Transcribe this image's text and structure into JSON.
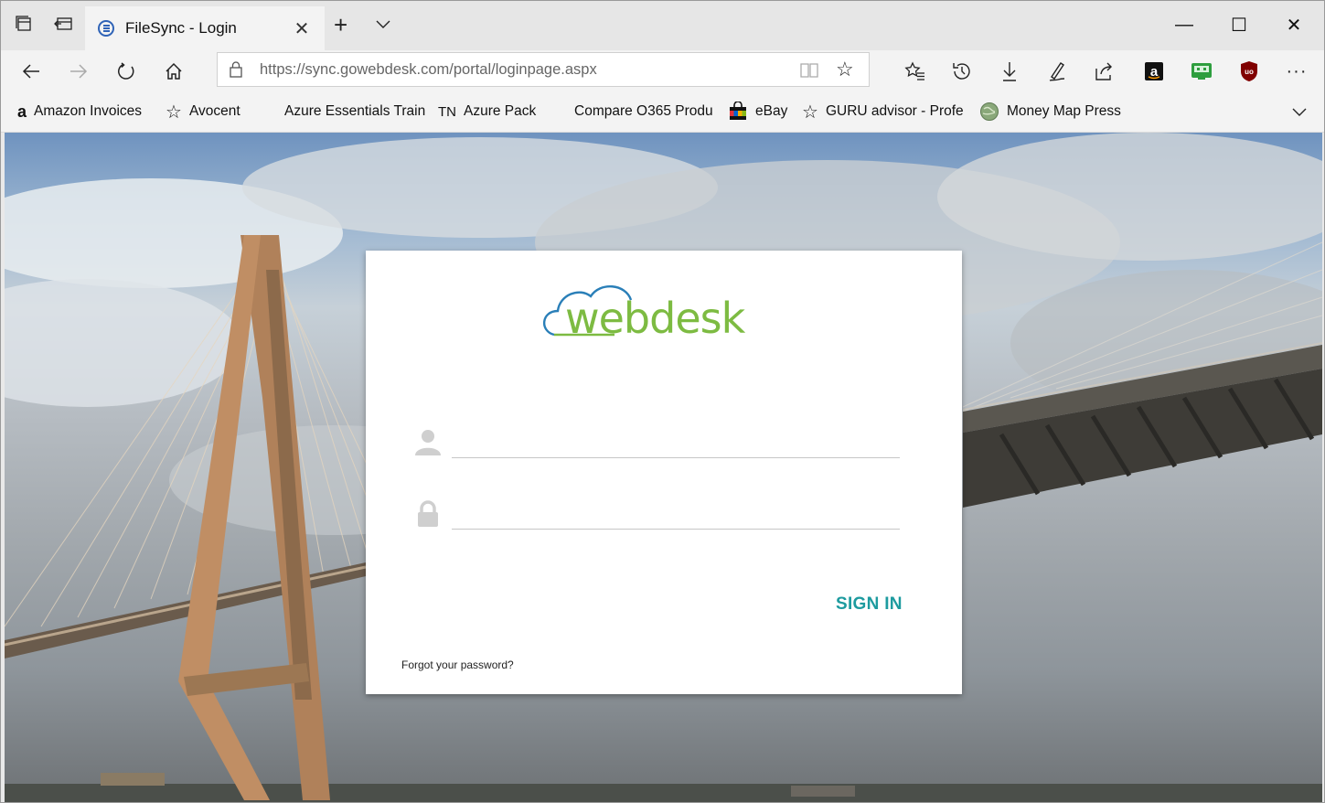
{
  "browser": {
    "tab": {
      "title": "FileSync - Login",
      "close": "✕"
    },
    "new_tab": "+",
    "window_controls": {
      "minimize": "—",
      "maximize": "☐",
      "close": "✕"
    },
    "address": {
      "url": "https://sync.gowebdesk.com/portal/loginpage.aspx"
    },
    "toolbar_icons": [
      "back-icon",
      "forward-icon",
      "refresh-icon",
      "home-icon",
      "lock-icon",
      "reading-view-icon",
      "favorite-star-icon",
      "favorites-hub-icon",
      "history-icon",
      "downloads-icon",
      "pen-icon",
      "share-icon",
      "amazon-extension-icon",
      "monitor-extension-icon",
      "ublock-extension-icon",
      "more-icon"
    ],
    "more_label": "···"
  },
  "favorites": [
    {
      "label": "Amazon Invoices",
      "icon": "amazon-icon",
      "glyph": "a"
    },
    {
      "label": "Avocent",
      "icon": "star-outline-icon",
      "glyph": "☆"
    },
    {
      "label": "Azure Essentials Train",
      "icon": "microsoft-logo-icon",
      "glyph": ""
    },
    {
      "label": "Azure Pack",
      "icon": "tn-icon",
      "glyph": "TN"
    },
    {
      "label": "Compare O365 Produ",
      "icon": "microsoft-logo-icon",
      "glyph": ""
    },
    {
      "label": "eBay",
      "icon": "shopping-bag-icon",
      "glyph": ""
    },
    {
      "label": "GURU advisor - Profe",
      "icon": "star-outline-icon",
      "glyph": "☆"
    },
    {
      "label": "Money Map Press",
      "icon": "globe-icon",
      "glyph": ""
    }
  ],
  "login": {
    "logo_text": "webdesk",
    "username_placeholder": "",
    "password_placeholder": "",
    "sign_in": "SIGN IN",
    "forgot": "Forgot your password?"
  },
  "colors": {
    "accent": "#1d9b9f",
    "logo_blue": "#2a7fb8",
    "logo_green": "#7dbb42",
    "tab_bar": "#e6e6e6",
    "toolbar": "#f3f3f3"
  }
}
